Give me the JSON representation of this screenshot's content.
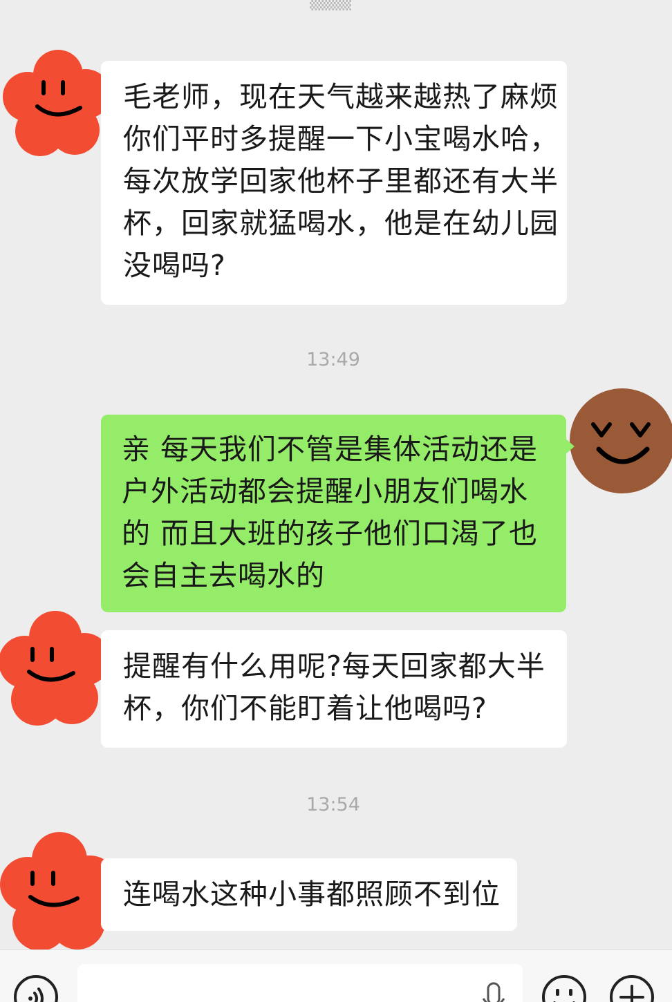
{
  "messages": [
    {
      "side": "left",
      "lines": [
        "毛老师，现在天气越来越热了麻烦",
        "你们平时多提醒一下小宝喝水哈，",
        "每次放学回家他杯子里都还有大半",
        "杯，回家就猛喝水，他是在幼儿园",
        "没喝吗?"
      ]
    },
    {
      "side": "right",
      "lines": [
        "亲 每天我们不管是集体活动还是",
        "户外活动都会提醒小朋友们喝水",
        "的 而且大班的孩子他们口渴了也",
        "会自主去喝水的"
      ]
    },
    {
      "side": "left",
      "lines": [
        "提醒有什么用呢?每天回家都大半",
        "杯，你们不能盯着让他喝吗?"
      ]
    },
    {
      "side": "left",
      "lines": [
        "连喝水这种小事都照顾不到位"
      ]
    }
  ],
  "timestamps": [
    "13:49",
    "13:54"
  ],
  "colors": {
    "background": "#ededed",
    "sent_bubble": "#95ec69",
    "received_bubble": "#ffffff",
    "received_avatar": "#f24c33",
    "sent_avatar": "#9a5a37",
    "timestamp_text": "#a9a9a9"
  },
  "icons": {
    "received_avatar": "red-flower-smiley-icon",
    "sent_avatar": "brown-laughing-face-icon",
    "voice": "voice-input-icon",
    "mic": "microphone-icon",
    "emoji": "emoji-icon",
    "more": "plus-icon"
  }
}
